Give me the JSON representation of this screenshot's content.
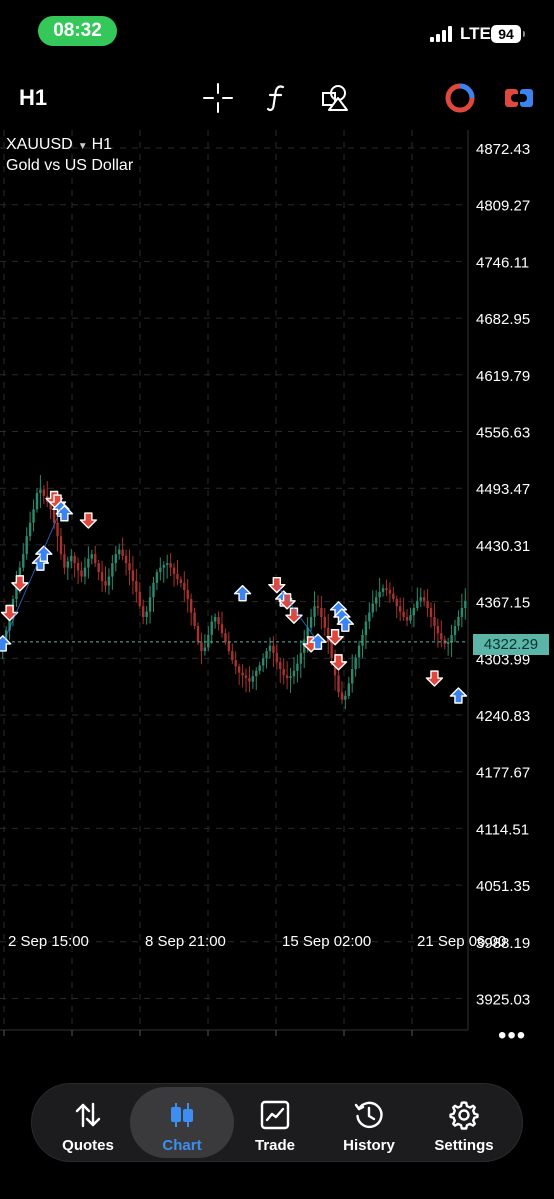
{
  "status_bar": {
    "time": "08:32",
    "network": "LTE",
    "battery": "94"
  },
  "toolbar": {
    "timeframe": "H1",
    "icons": [
      "crosshair-icon",
      "function-icon",
      "objects-icon",
      "trading-signals-icon",
      "one-click-trading-icon"
    ]
  },
  "chart": {
    "symbol": "XAUUSD",
    "timeframe": "H1",
    "description": "Gold vs US Dollar",
    "current_price": "4322.29",
    "accent_up": "#3a83f1",
    "accent_down": "#e0483e",
    "bull_candle": "#2a8a6e",
    "bear_candle": "#a8322e"
  },
  "chart_data": {
    "type": "candlestick",
    "y_ticks": [
      "4872.43",
      "4809.27",
      "4746.11",
      "4682.95",
      "4619.79",
      "4556.63",
      "4493.47",
      "4430.31",
      "4367.15",
      "4303.99",
      "4240.83",
      "4177.67",
      "4114.51",
      "4051.35",
      "3988.19",
      "3925.03"
    ],
    "x_ticks": [
      "2 Sep 15:00",
      "8 Sep 21:00",
      "15 Sep 02:00",
      "21 Sep 06:00"
    ],
    "ylim": [
      3900,
      4890
    ],
    "close_profile": [
      4320,
      4335,
      4355,
      4370,
      4390,
      4405,
      4420,
      4440,
      4455,
      4470,
      4488,
      4492,
      4485,
      4478,
      4470,
      4455,
      4440,
      4420,
      4405,
      4412,
      4418,
      4410,
      4402,
      4395,
      4405,
      4415,
      4420,
      4410,
      4400,
      4390,
      4385,
      4395,
      4410,
      4420,
      4425,
      4418,
      4410,
      4402,
      4390,
      4378,
      4362,
      4350,
      4356,
      4372,
      4388,
      4400,
      4405,
      4408,
      4410,
      4405,
      4398,
      4392,
      4388,
      4380,
      4370,
      4355,
      4340,
      4322,
      4312,
      4316,
      4330,
      4345,
      4350,
      4342,
      4332,
      4322,
      4312,
      4302,
      4295,
      4288,
      4285,
      4282,
      4278,
      4284,
      4290,
      4296,
      4304,
      4312,
      4318,
      4310,
      4300,
      4292,
      4285,
      4282,
      4284,
      4290,
      4298,
      4310,
      4325,
      4338,
      4350,
      4362,
      4360,
      4350,
      4338,
      4322,
      4304,
      4285,
      4266,
      4258,
      4262,
      4276,
      4292,
      4305,
      4318,
      4330,
      4345,
      4355,
      4365,
      4372,
      4378,
      4382,
      4380,
      4376,
      4370,
      4362,
      4356,
      4350,
      4346,
      4352,
      4360,
      4368,
      4372,
      4368,
      4360,
      4350,
      4340,
      4332,
      4325,
      4320,
      4322,
      4330,
      4340,
      4350,
      4360,
      4368
    ],
    "markers": [
      {
        "x": 0,
        "y": 4320,
        "dir": "up"
      },
      {
        "x": 2,
        "y": 4355,
        "dir": "down"
      },
      {
        "x": 5,
        "y": 4388,
        "dir": "down"
      },
      {
        "x": 11,
        "y": 4410,
        "dir": "up"
      },
      {
        "x": 12,
        "y": 4420,
        "dir": "up"
      },
      {
        "x": 15,
        "y": 4482,
        "dir": "down"
      },
      {
        "x": 16,
        "y": 4478,
        "dir": "down"
      },
      {
        "x": 17,
        "y": 4470,
        "dir": "up"
      },
      {
        "x": 18,
        "y": 4465,
        "dir": "up"
      },
      {
        "x": 25,
        "y": 4458,
        "dir": "down"
      },
      {
        "x": 70,
        "y": 4376,
        "dir": "up"
      },
      {
        "x": 80,
        "y": 4386,
        "dir": "down"
      },
      {
        "x": 82,
        "y": 4370,
        "dir": "up"
      },
      {
        "x": 83,
        "y": 4368,
        "dir": "down"
      },
      {
        "x": 85,
        "y": 4352,
        "dir": "down"
      },
      {
        "x": 90,
        "y": 4320,
        "dir": "down"
      },
      {
        "x": 92,
        "y": 4322,
        "dir": "up"
      },
      {
        "x": 97,
        "y": 4328,
        "dir": "down"
      },
      {
        "x": 98,
        "y": 4358,
        "dir": "up"
      },
      {
        "x": 99,
        "y": 4350,
        "dir": "up"
      },
      {
        "x": 100,
        "y": 4342,
        "dir": "up"
      },
      {
        "x": 98,
        "y": 4300,
        "dir": "down"
      },
      {
        "x": 126,
        "y": 4282,
        "dir": "down"
      },
      {
        "x": 133,
        "y": 4262,
        "dir": "up"
      }
    ]
  },
  "more_menu": "•••",
  "tabbar": {
    "quotes": "Quotes",
    "chart": "Chart",
    "trade": "Trade",
    "history": "History",
    "settings": "Settings"
  }
}
